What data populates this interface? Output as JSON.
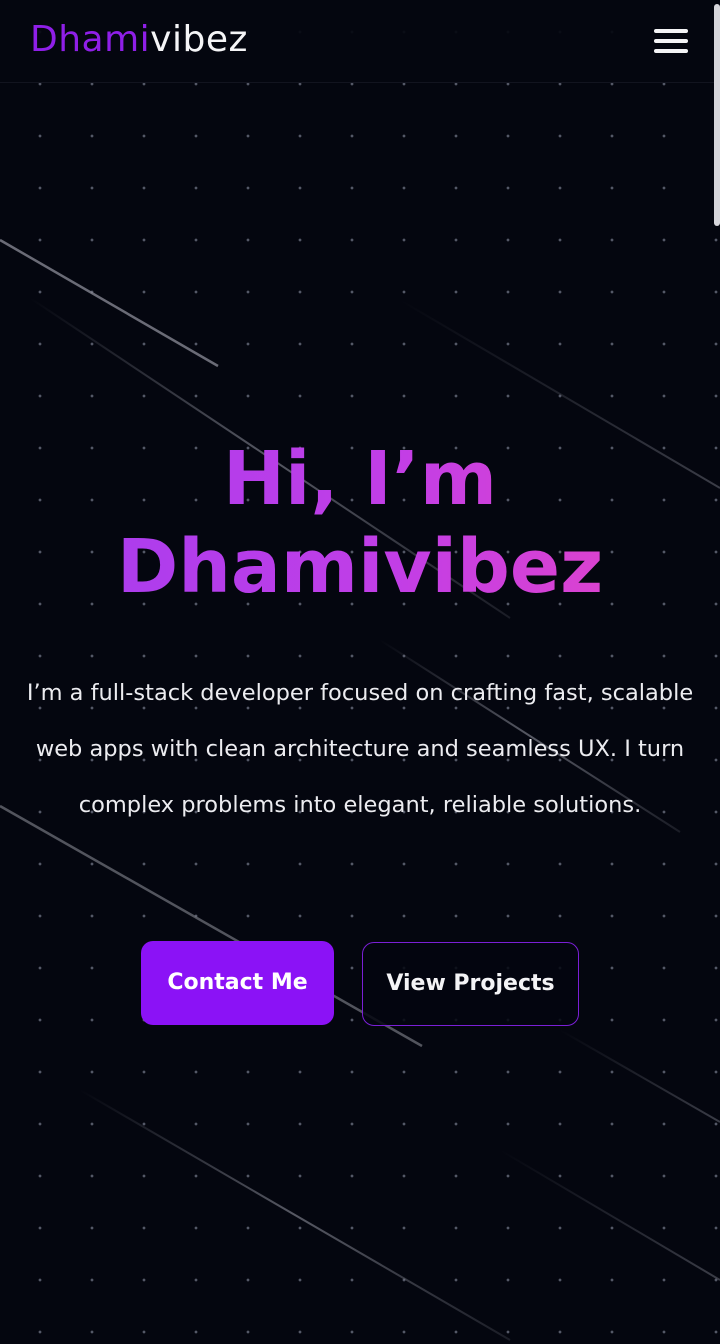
{
  "header": {
    "brand_accent": "Dhami",
    "brand_rest": "vibez",
    "menu_icon": "hamburger-menu-icon"
  },
  "hero": {
    "greeting_line1": "Hi, I’m",
    "greeting_line2": "Dhamivibez",
    "tagline": "I’m a full-stack developer focused on crafting fast, scalable web apps with clean architecture and seamless UX. I turn complex problems into elegant, reliable solutions."
  },
  "actions": {
    "primary_label": "Contact Me",
    "secondary_label": "View Projects"
  },
  "colors": {
    "background": "#04060f",
    "brand_accent": "#8f1fe8",
    "primary_button": "#8b12f6",
    "secondary_border": "#7a1fd6",
    "heading_gradient_start": "#a43cf0",
    "heading_gradient_end": "#e845c4"
  }
}
